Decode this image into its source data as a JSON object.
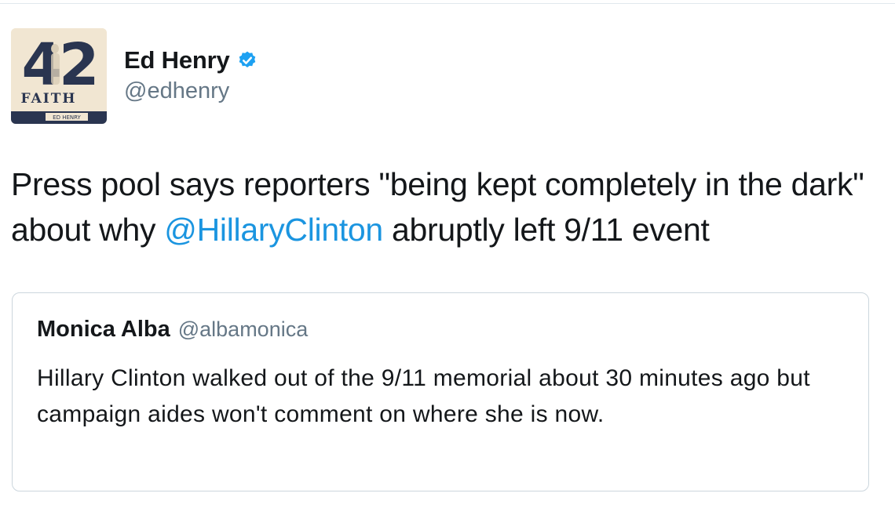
{
  "author": {
    "display_name": "Ed Henry",
    "handle": "@edhenry",
    "verified": true,
    "verified_icon": "verified-badge-icon",
    "avatar_text_number": "42",
    "avatar_text_word": "FAITH",
    "avatar_text_author": "ED HENRY"
  },
  "tweet": {
    "text_before": "Press pool says reporters \"being kept completely in the dark\" about why ",
    "mention": "@HillaryClinton",
    "text_after": " abruptly left 9/11 event"
  },
  "quoted_tweet": {
    "display_name": "Monica Alba",
    "handle": "@albamonica",
    "text": "Hillary Clinton walked out of the 9/11 memorial about 30 minutes ago but campaign aides won't comment on where she is now."
  },
  "colors": {
    "link": "#1b95e0",
    "verified": "#1da1f2",
    "secondary_text": "#657786",
    "primary_text": "#14171a",
    "card_border": "#ccd6dd"
  }
}
